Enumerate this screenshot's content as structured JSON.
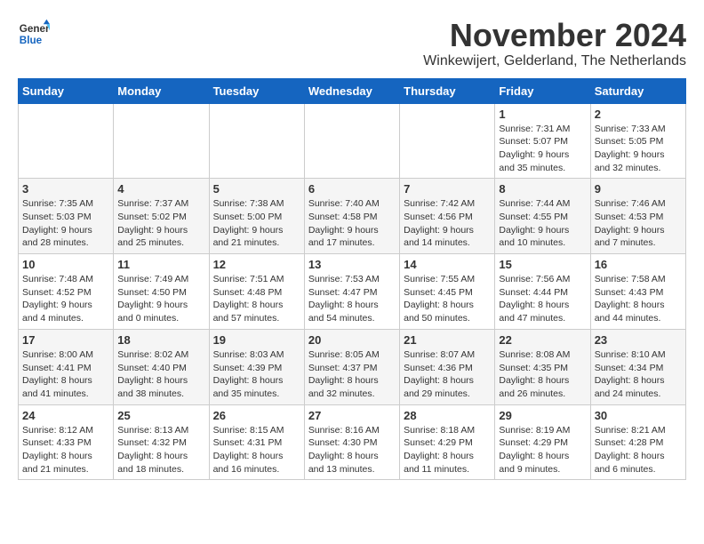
{
  "header": {
    "logo_line1": "General",
    "logo_line2": "Blue",
    "month_year": "November 2024",
    "location": "Winkewijert, Gelderland, The Netherlands"
  },
  "weekdays": [
    "Sunday",
    "Monday",
    "Tuesday",
    "Wednesday",
    "Thursday",
    "Friday",
    "Saturday"
  ],
  "weeks": [
    [
      {
        "day": "",
        "info": ""
      },
      {
        "day": "",
        "info": ""
      },
      {
        "day": "",
        "info": ""
      },
      {
        "day": "",
        "info": ""
      },
      {
        "day": "",
        "info": ""
      },
      {
        "day": "1",
        "info": "Sunrise: 7:31 AM\nSunset: 5:07 PM\nDaylight: 9 hours\nand 35 minutes."
      },
      {
        "day": "2",
        "info": "Sunrise: 7:33 AM\nSunset: 5:05 PM\nDaylight: 9 hours\nand 32 minutes."
      }
    ],
    [
      {
        "day": "3",
        "info": "Sunrise: 7:35 AM\nSunset: 5:03 PM\nDaylight: 9 hours\nand 28 minutes."
      },
      {
        "day": "4",
        "info": "Sunrise: 7:37 AM\nSunset: 5:02 PM\nDaylight: 9 hours\nand 25 minutes."
      },
      {
        "day": "5",
        "info": "Sunrise: 7:38 AM\nSunset: 5:00 PM\nDaylight: 9 hours\nand 21 minutes."
      },
      {
        "day": "6",
        "info": "Sunrise: 7:40 AM\nSunset: 4:58 PM\nDaylight: 9 hours\nand 17 minutes."
      },
      {
        "day": "7",
        "info": "Sunrise: 7:42 AM\nSunset: 4:56 PM\nDaylight: 9 hours\nand 14 minutes."
      },
      {
        "day": "8",
        "info": "Sunrise: 7:44 AM\nSunset: 4:55 PM\nDaylight: 9 hours\nand 10 minutes."
      },
      {
        "day": "9",
        "info": "Sunrise: 7:46 AM\nSunset: 4:53 PM\nDaylight: 9 hours\nand 7 minutes."
      }
    ],
    [
      {
        "day": "10",
        "info": "Sunrise: 7:48 AM\nSunset: 4:52 PM\nDaylight: 9 hours\nand 4 minutes."
      },
      {
        "day": "11",
        "info": "Sunrise: 7:49 AM\nSunset: 4:50 PM\nDaylight: 9 hours\nand 0 minutes."
      },
      {
        "day": "12",
        "info": "Sunrise: 7:51 AM\nSunset: 4:48 PM\nDaylight: 8 hours\nand 57 minutes."
      },
      {
        "day": "13",
        "info": "Sunrise: 7:53 AM\nSunset: 4:47 PM\nDaylight: 8 hours\nand 54 minutes."
      },
      {
        "day": "14",
        "info": "Sunrise: 7:55 AM\nSunset: 4:45 PM\nDaylight: 8 hours\nand 50 minutes."
      },
      {
        "day": "15",
        "info": "Sunrise: 7:56 AM\nSunset: 4:44 PM\nDaylight: 8 hours\nand 47 minutes."
      },
      {
        "day": "16",
        "info": "Sunrise: 7:58 AM\nSunset: 4:43 PM\nDaylight: 8 hours\nand 44 minutes."
      }
    ],
    [
      {
        "day": "17",
        "info": "Sunrise: 8:00 AM\nSunset: 4:41 PM\nDaylight: 8 hours\nand 41 minutes."
      },
      {
        "day": "18",
        "info": "Sunrise: 8:02 AM\nSunset: 4:40 PM\nDaylight: 8 hours\nand 38 minutes."
      },
      {
        "day": "19",
        "info": "Sunrise: 8:03 AM\nSunset: 4:39 PM\nDaylight: 8 hours\nand 35 minutes."
      },
      {
        "day": "20",
        "info": "Sunrise: 8:05 AM\nSunset: 4:37 PM\nDaylight: 8 hours\nand 32 minutes."
      },
      {
        "day": "21",
        "info": "Sunrise: 8:07 AM\nSunset: 4:36 PM\nDaylight: 8 hours\nand 29 minutes."
      },
      {
        "day": "22",
        "info": "Sunrise: 8:08 AM\nSunset: 4:35 PM\nDaylight: 8 hours\nand 26 minutes."
      },
      {
        "day": "23",
        "info": "Sunrise: 8:10 AM\nSunset: 4:34 PM\nDaylight: 8 hours\nand 24 minutes."
      }
    ],
    [
      {
        "day": "24",
        "info": "Sunrise: 8:12 AM\nSunset: 4:33 PM\nDaylight: 8 hours\nand 21 minutes."
      },
      {
        "day": "25",
        "info": "Sunrise: 8:13 AM\nSunset: 4:32 PM\nDaylight: 8 hours\nand 18 minutes."
      },
      {
        "day": "26",
        "info": "Sunrise: 8:15 AM\nSunset: 4:31 PM\nDaylight: 8 hours\nand 16 minutes."
      },
      {
        "day": "27",
        "info": "Sunrise: 8:16 AM\nSunset: 4:30 PM\nDaylight: 8 hours\nand 13 minutes."
      },
      {
        "day": "28",
        "info": "Sunrise: 8:18 AM\nSunset: 4:29 PM\nDaylight: 8 hours\nand 11 minutes."
      },
      {
        "day": "29",
        "info": "Sunrise: 8:19 AM\nSunset: 4:29 PM\nDaylight: 8 hours\nand 9 minutes."
      },
      {
        "day": "30",
        "info": "Sunrise: 8:21 AM\nSunset: 4:28 PM\nDaylight: 8 hours\nand 6 minutes."
      }
    ]
  ]
}
